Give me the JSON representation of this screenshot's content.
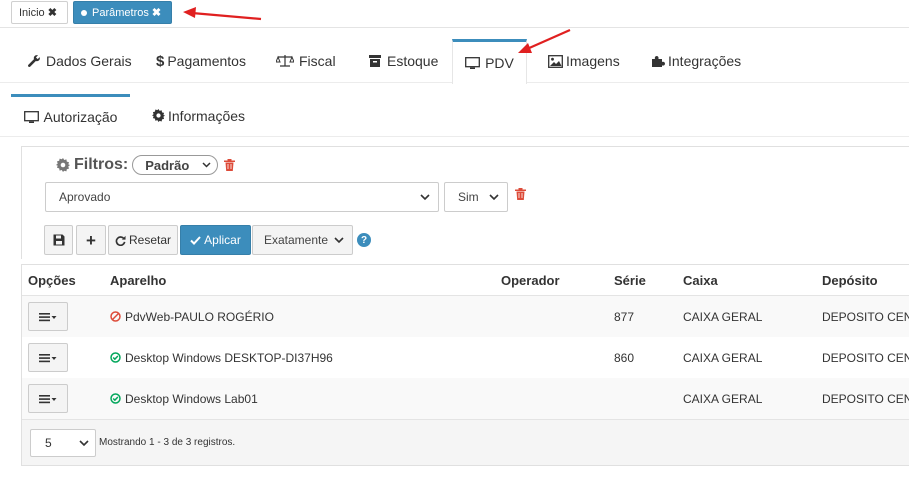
{
  "top_tabs": {
    "inicio": "Inicio",
    "parametros": "Parâmetros"
  },
  "main_tabs": [
    {
      "label": "Dados Gerais",
      "icon": "wrench-icon"
    },
    {
      "label": "Pagamentos",
      "icon": "dollar-icon"
    },
    {
      "label": "Fiscal",
      "icon": "balance-scale-icon"
    },
    {
      "label": "Estoque",
      "icon": "archive-icon"
    },
    {
      "label": "PDV",
      "icon": "desktop-icon"
    },
    {
      "label": "Imagens",
      "icon": "image-icon"
    },
    {
      "label": "Integrações",
      "icon": "puzzle-icon"
    }
  ],
  "sub_tabs": [
    {
      "label": "Autorização",
      "icon": "desktop-icon"
    },
    {
      "label": "Informações",
      "icon": "gear-icon"
    }
  ],
  "filters": {
    "title": "Filtros:",
    "preset": "Padrão",
    "field_value": "Aprovado",
    "field_option": "Sim",
    "reset_label": "Resetar",
    "apply_label": "Aplicar",
    "match_mode": "Exatamente"
  },
  "table": {
    "headers": {
      "opcoes": "Opções",
      "aparelho": "Aparelho",
      "operador": "Operador",
      "serie": "Série",
      "caixa": "Caixa",
      "deposito": "Depósito"
    },
    "rows": [
      {
        "status": "blocked",
        "aparelho": "PdvWeb-PAULO ROGÉRIO",
        "operador": "",
        "serie": "877",
        "caixa": "CAIXA GERAL",
        "deposito": "DEPOSITO CENT"
      },
      {
        "status": "approved",
        "aparelho": "Desktop Windows DESKTOP-DI37H96",
        "operador": "",
        "serie": "860",
        "caixa": "CAIXA GERAL",
        "deposito": "DEPOSITO CENT"
      },
      {
        "status": "approved",
        "aparelho": "Desktop Windows Lab01",
        "operador": "",
        "serie": "",
        "caixa": "CAIXA GERAL",
        "deposito": "DEPOSITO CENT"
      }
    ],
    "page_size": "5",
    "info": "Mostrando 1 - 3 de 3 registros."
  },
  "colors": {
    "primary": "#3c8dbc",
    "danger": "#dd4b39",
    "success": "#00a65a",
    "annotation": "#e02020"
  }
}
